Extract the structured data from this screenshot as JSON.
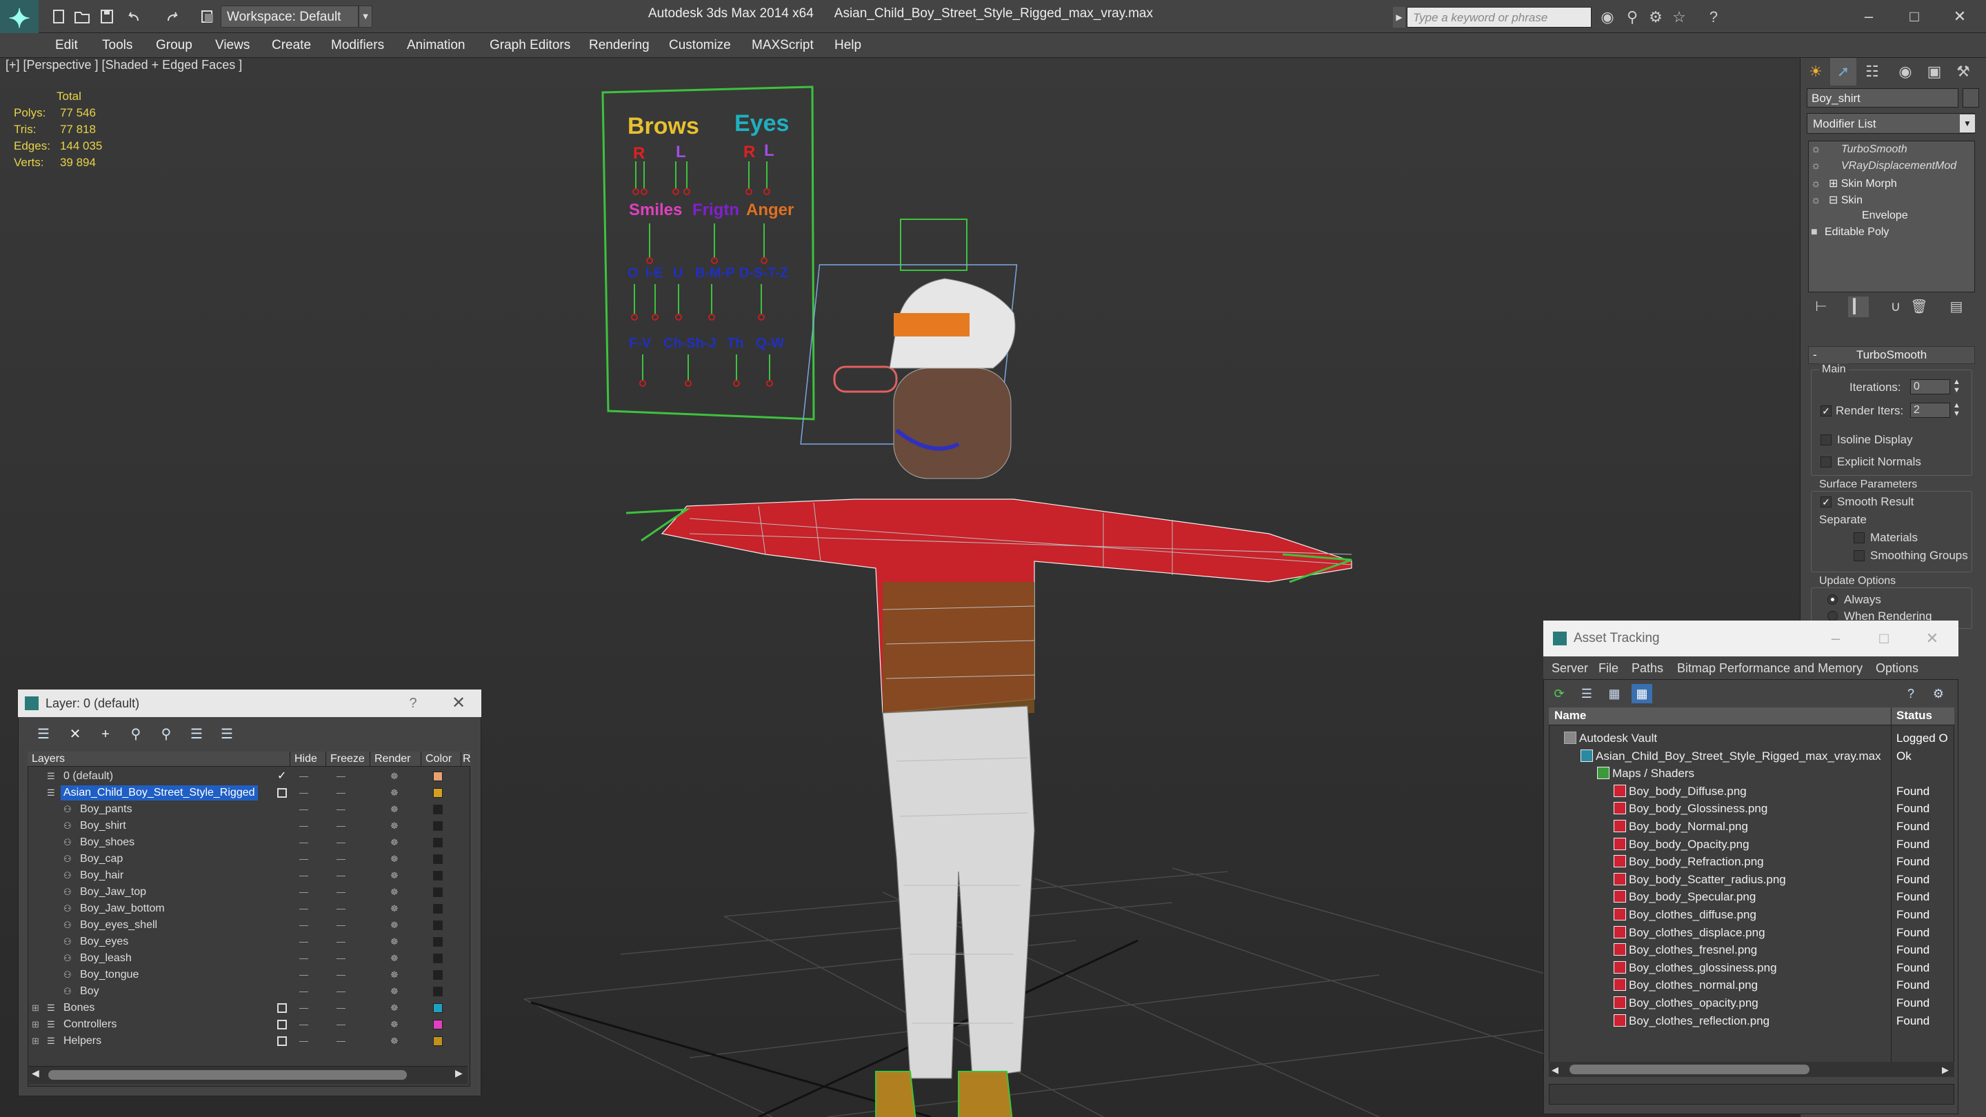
{
  "window": {
    "app_title": "Autodesk 3ds Max  2014 x64",
    "file_title": "Asian_Child_Boy_Street_Style_Rigged_max_vray.max",
    "workspace": "Workspace: Default",
    "search_placeholder": "Type a keyword or phrase"
  },
  "menu": [
    "Edit",
    "Tools",
    "Group",
    "Views",
    "Create",
    "Modifiers",
    "Animation",
    "Graph Editors",
    "Rendering",
    "Customize",
    "MAXScript",
    "Help"
  ],
  "viewport": {
    "label": "[+] [Perspective ] [Shaded + Edged Faces ]",
    "stats": {
      "total_label": "Total",
      "rows": [
        {
          "label": "Polys:",
          "value": "77 546"
        },
        {
          "label": "Tris:",
          "value": "77 818"
        },
        {
          "label": "Edges:",
          "value": "144 035"
        },
        {
          "label": "Verts:",
          "value": "39 894"
        }
      ]
    },
    "face_controls": {
      "brows": "Brows",
      "eyes": "Eyes",
      "r": "R",
      "l": "L",
      "smiles": "Smiles",
      "frigtn": "Frigtn",
      "anger": "Anger",
      "phonemes1": [
        "O",
        "I-E",
        "U",
        "B-M-P",
        "D-S-T-Z"
      ],
      "phonemes2": [
        "F-V",
        "Ch-Sh-J",
        "Th",
        "Q-W"
      ]
    }
  },
  "command_panel": {
    "object_name": "Boy_shirt",
    "modifier_list": "Modifier List",
    "stack": [
      {
        "label": "TurboSmooth",
        "italic": true
      },
      {
        "label": "VRayDisplacementMod",
        "italic": true
      },
      {
        "label": "Skin Morph",
        "italic": false
      },
      {
        "label": "Skin",
        "italic": false
      },
      {
        "label": "Envelope",
        "italic": false
      },
      {
        "label": "Editable Poly",
        "italic": false
      }
    ],
    "turbosmooth": {
      "title": "TurboSmooth",
      "main": "Main",
      "iterations_label": "Iterations:",
      "iterations_value": "0",
      "render_iters_label": "Render Iters:",
      "render_iters_value": "2",
      "isoline": "Isoline Display",
      "explicit": "Explicit Normals",
      "surface_params": "Surface Parameters",
      "smooth_result": "Smooth Result",
      "separate": "Separate",
      "materials": "Materials",
      "smoothing_groups": "Smoothing Groups",
      "update_options": "Update Options",
      "always": "Always",
      "when_rendering": "When Rendering"
    }
  },
  "layer_panel": {
    "title": "Layer: 0 (default)",
    "columns": [
      "Layers",
      "Hide",
      "Freeze",
      "Render",
      "Color",
      "R"
    ],
    "rows": [
      {
        "name": "0 (default)",
        "indent": 0,
        "check": "✓",
        "color": "#e8a070"
      },
      {
        "name": "Asian_Child_Boy_Street_Style_Rigged",
        "indent": 0,
        "selected": true,
        "color": "#d4a020"
      },
      {
        "name": "Boy_pants",
        "indent": 1,
        "color": "#202020"
      },
      {
        "name": "Boy_shirt",
        "indent": 1,
        "color": "#202020"
      },
      {
        "name": "Boy_shoes",
        "indent": 1,
        "color": "#202020"
      },
      {
        "name": "Boy_cap",
        "indent": 1,
        "color": "#202020"
      },
      {
        "name": "Boy_hair",
        "indent": 1,
        "color": "#202020"
      },
      {
        "name": "Boy_Jaw_top",
        "indent": 1,
        "color": "#202020"
      },
      {
        "name": "Boy_Jaw_bottom",
        "indent": 1,
        "color": "#202020"
      },
      {
        "name": "Boy_eyes_shell",
        "indent": 1,
        "color": "#202020"
      },
      {
        "name": "Boy_eyes",
        "indent": 1,
        "color": "#202020"
      },
      {
        "name": "Boy_leash",
        "indent": 1,
        "color": "#202020"
      },
      {
        "name": "Boy_tongue",
        "indent": 1,
        "color": "#202020"
      },
      {
        "name": "Boy",
        "indent": 1,
        "color": "#202020"
      },
      {
        "name": "Bones",
        "indent": 0,
        "expand": true,
        "color": "#20a0c0"
      },
      {
        "name": "Controllers",
        "indent": 0,
        "expand": true,
        "color": "#e040c0"
      },
      {
        "name": "Helpers",
        "indent": 0,
        "expand": true,
        "color": "#c09020"
      }
    ]
  },
  "asset_tracking": {
    "title": "Asset Tracking",
    "menu": [
      "Server",
      "File",
      "Paths",
      "Bitmap Performance and Memory",
      "Options"
    ],
    "col_name": "Name",
    "col_status": "Status",
    "rows": [
      {
        "name": "Autodesk Vault",
        "indent": 0,
        "status": "Logged O"
      },
      {
        "name": "Asian_Child_Boy_Street_Style_Rigged_max_vray.max",
        "indent": 1,
        "status": "Ok"
      },
      {
        "name": "Maps / Shaders",
        "indent": 2,
        "status": ""
      },
      {
        "name": "Boy_body_Diffuse.png",
        "indent": 3,
        "status": "Found"
      },
      {
        "name": "Boy_body_Glossiness.png",
        "indent": 3,
        "status": "Found"
      },
      {
        "name": "Boy_body_Normal.png",
        "indent": 3,
        "status": "Found"
      },
      {
        "name": "Boy_body_Opacity.png",
        "indent": 3,
        "status": "Found"
      },
      {
        "name": "Boy_body_Refraction.png",
        "indent": 3,
        "status": "Found"
      },
      {
        "name": "Boy_body_Scatter_radius.png",
        "indent": 3,
        "status": "Found"
      },
      {
        "name": "Boy_body_Specular.png",
        "indent": 3,
        "status": "Found"
      },
      {
        "name": "Boy_clothes_diffuse.png",
        "indent": 3,
        "status": "Found"
      },
      {
        "name": "Boy_clothes_displace.png",
        "indent": 3,
        "status": "Found"
      },
      {
        "name": "Boy_clothes_fresnel.png",
        "indent": 3,
        "status": "Found"
      },
      {
        "name": "Boy_clothes_glossiness.png",
        "indent": 3,
        "status": "Found"
      },
      {
        "name": "Boy_clothes_normal.png",
        "indent": 3,
        "status": "Found"
      },
      {
        "name": "Boy_clothes_opacity.png",
        "indent": 3,
        "status": "Found"
      },
      {
        "name": "Boy_clothes_reflection.png",
        "indent": 3,
        "status": "Found"
      }
    ]
  }
}
